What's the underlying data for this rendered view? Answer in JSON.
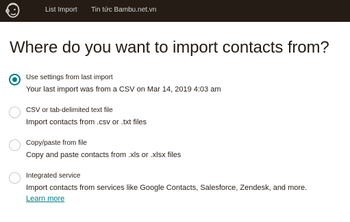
{
  "nav": {
    "logo_icon": "freddie-logo-icon",
    "links": [
      "List Import",
      "Tin tức Bambu.net.vn"
    ]
  },
  "page": {
    "title": "Where do you want to import contacts from?"
  },
  "options": [
    {
      "label": "Use settings from last import",
      "description": "Your last import was from a CSV on Mar 14, 2019 4:03 am",
      "selected": true
    },
    {
      "label": "CSV or tab-delimited text file",
      "description": "Import contacts from .csv or .txt files",
      "selected": false
    },
    {
      "label": "Copy/paste from file",
      "description": "Copy and paste contacts from .xls or .xlsx files",
      "selected": false
    },
    {
      "label": "Integrated service",
      "description": "Import contacts from services like Google Contacts, Salesforce, Zendesk, and more.",
      "learn_more": "Learn more",
      "selected": false
    }
  ],
  "colors": {
    "topbar": "#241c15",
    "accent": "#007c89",
    "text": "#241c15"
  }
}
